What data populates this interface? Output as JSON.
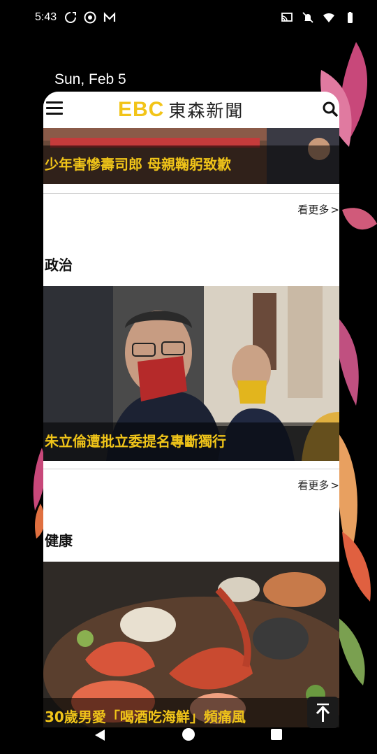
{
  "status_bar": {
    "time": "5:43",
    "left_icons": [
      "sync-icon",
      "chrome-icon",
      "gmail-icon"
    ],
    "right_icons": [
      "cast-icon",
      "mute-icon",
      "wifi-icon",
      "battery-icon"
    ]
  },
  "lockscreen": {
    "date": "Sun, Feb 5"
  },
  "app": {
    "logo_mark": "EBC",
    "logo_text": "東森新聞",
    "menu_icon": "hamburger-menu-icon",
    "search_icon": "search-icon"
  },
  "feed": {
    "top_story": {
      "caption": "少年害慘壽司郎 母親鞠躬致歉"
    },
    "sections": [
      {
        "title": "政治",
        "see_more": "看更多",
        "story_caption": "朱立倫遭批立委提名專斷獨行"
      },
      {
        "title": "健康",
        "see_more": "看更多",
        "story_caption": "30歲男愛「喝酒吃海鮮」頻痛風"
      }
    ]
  },
  "scroll_top_icon": "arrow-up-to-top-icon",
  "nav": {
    "back_icon": "back-triangle-icon",
    "home_icon": "home-circle-icon",
    "recent_icon": "recents-square-icon"
  },
  "colors": {
    "caption_yellow": "#f0c419",
    "logo_yellow": "#f2c419",
    "background": "#000000"
  }
}
